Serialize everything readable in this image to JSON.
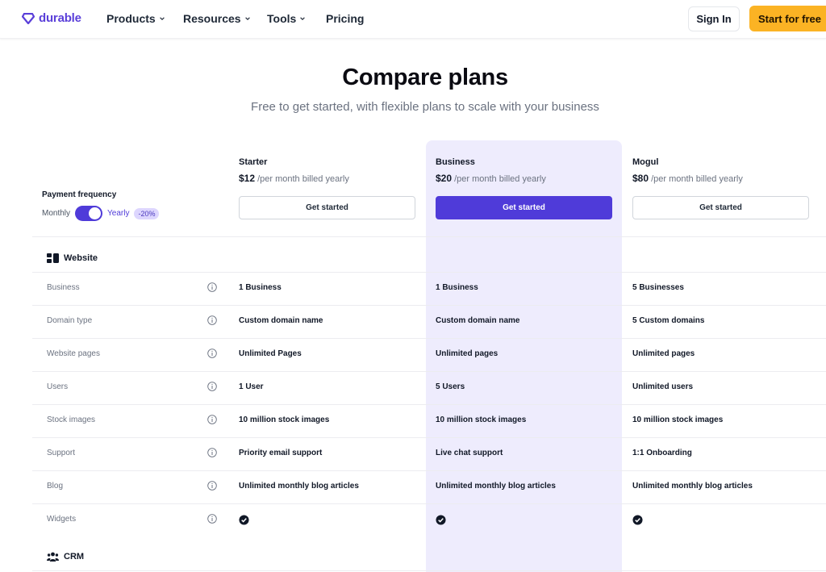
{
  "nav": {
    "logo_text": "durable",
    "menu": [
      {
        "label": "Products",
        "has_dropdown": true
      },
      {
        "label": "Resources",
        "has_dropdown": true
      },
      {
        "label": "Tools",
        "has_dropdown": true
      },
      {
        "label": "Pricing",
        "has_dropdown": false
      }
    ],
    "signin_label": "Sign In",
    "cta_label": "Start for free"
  },
  "header": {
    "title": "Compare plans",
    "subtitle": "Free to get started, with flexible plans to scale with your business"
  },
  "payment": {
    "label": "Payment frequency",
    "monthly": "Monthly",
    "yearly": "Yearly",
    "discount": "-20%",
    "yearly_selected": true
  },
  "plans": [
    {
      "name": "Starter",
      "price": "$12",
      "period": "/per month billed yearly",
      "cta": "Get started",
      "highlighted": false
    },
    {
      "name": "Business",
      "price": "$20",
      "period": "/per month billed yearly",
      "cta": "Get started",
      "highlighted": true
    },
    {
      "name": "Mogul",
      "price": "$80",
      "period": "/per month billed yearly",
      "cta": "Get started",
      "highlighted": false
    }
  ],
  "sections": [
    {
      "title": "Website",
      "icon": "website-icon",
      "rows": [
        {
          "feature": "Business",
          "values": [
            "1 Business",
            "1 Business",
            "5 Businesses"
          ]
        },
        {
          "feature": "Domain type",
          "values": [
            "Custom domain name",
            "Custom domain name",
            "5 Custom domains"
          ]
        },
        {
          "feature": "Website pages",
          "values": [
            "Unlimited Pages",
            "Unlimited pages",
            "Unlimited pages"
          ]
        },
        {
          "feature": "Users",
          "values": [
            "1 User",
            "5 Users",
            "Unlimited users"
          ]
        },
        {
          "feature": "Stock images",
          "values": [
            "10 million stock images",
            "10 million stock images",
            "10 million stock images"
          ]
        },
        {
          "feature": "Support",
          "values": [
            "Priority email support",
            "Live chat support",
            "1:1 Onboarding"
          ]
        },
        {
          "feature": "Blog",
          "values": [
            "Unlimited monthly blog articles",
            "Unlimited monthly blog articles",
            "Unlimited monthly blog articles"
          ]
        },
        {
          "feature": "Widgets",
          "values": [
            "check",
            "check",
            "check"
          ]
        }
      ]
    },
    {
      "title": "CRM",
      "icon": "users-group-icon",
      "rows": []
    }
  ],
  "colors": {
    "brand": "#5a3fd9",
    "primary_button": "#4f3bd9",
    "cta": "#fbb324",
    "highlight_column": "#eeecfd"
  }
}
